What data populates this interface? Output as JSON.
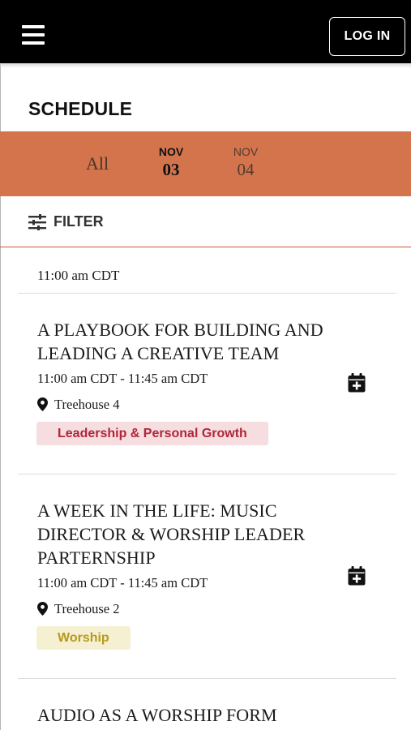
{
  "header": {
    "menu_icon": "hamburger-menu-icon",
    "login_label": "LOG IN"
  },
  "schedule": {
    "title": "SCHEDULE",
    "tabs": {
      "all": "All",
      "days": [
        {
          "month": "NOV",
          "day": "03",
          "selected": true
        },
        {
          "month": "NOV",
          "day": "04",
          "selected": false
        }
      ]
    },
    "filter_label": "FILTER",
    "filter_icon": "sliders-icon",
    "time_group": "11:00 am CDT",
    "sessions": [
      {
        "title": "A PLAYBOOK FOR BUILDING AND LEADING A CREATIVE TEAM",
        "time": "11:00 am CDT - 11:45 am CDT",
        "location": "Treehouse 4",
        "tag": "Leadership & Personal Growth",
        "tag_color": "#b0263a",
        "tag_bg": "#f6dde0"
      },
      {
        "title": "A WEEK IN THE LIFE: MUSIC DIRECTOR & WORSHIP LEADER PARTERNSHIP",
        "time": "11:00 am CDT - 11:45 am CDT",
        "location": "Treehouse 2",
        "tag": "Worship",
        "tag_color": "#b59a1c",
        "tag_bg": "#f6f0d2"
      },
      {
        "title": "AUDIO AS A WORSHIP FORM"
      }
    ]
  },
  "colors": {
    "topbar": "#000000",
    "date_bar": "#d4744c",
    "filter_rule": "#c9573a"
  }
}
